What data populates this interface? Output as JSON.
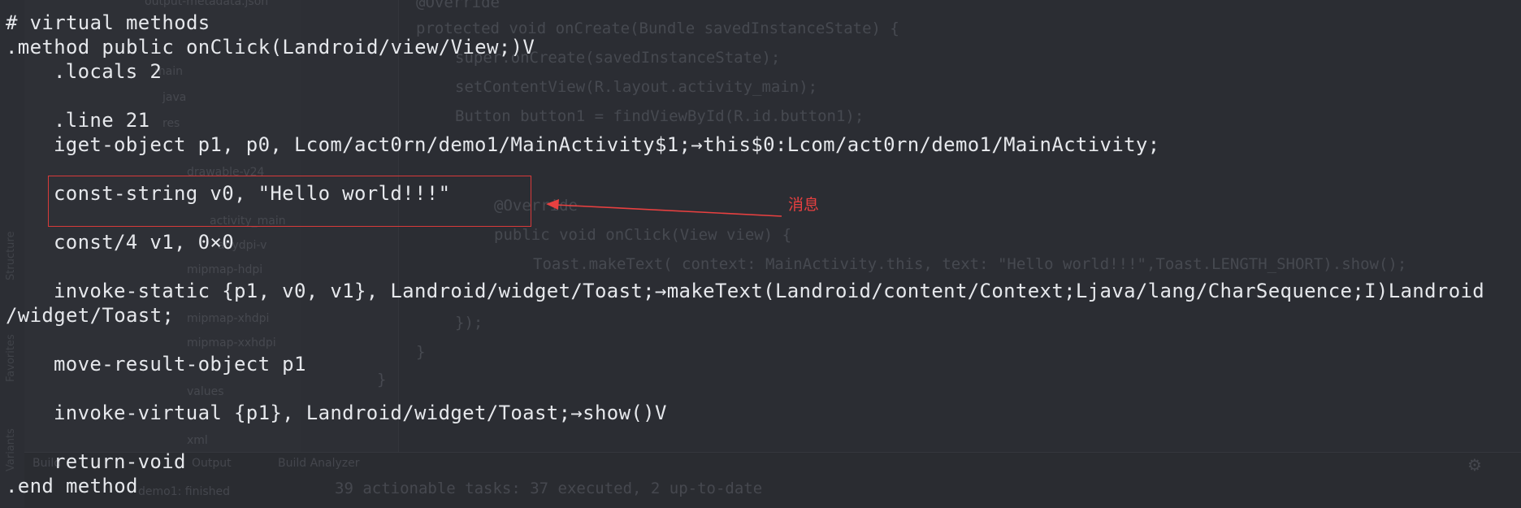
{
  "code_lines": [
    "# virtual methods",
    ".method public onClick(Landroid/view/View;)V",
    ".locals 2",
    ".line 21",
    "iget-object p1, p0, Lcom/act0rn/demo1/MainActivity$1;→this$0:Lcom/act0rn/demo1/MainActivity;",
    "const-string v0, \"Hello world!!!\"",
    "const/4 v1, 0×0",
    "invoke-static {p1, v0, v1}, Landroid/widget/Toast;→makeText(Landroid/content/Context;Ljava/lang/CharSequence;I)Landroid",
    "/widget/Toast;",
    "move-result-object p1",
    "invoke-virtual {p1}, Landroid/widget/Toast;→show()V",
    "return-void",
    ".end method"
  ],
  "annotation": {
    "label": "消息",
    "color": "#e84040"
  },
  "background_ide": {
    "java_lines": [
      "@Override",
      "protected void onCreate(Bundle savedInstanceState) {",
      "super.onCreate(savedInstanceState);",
      "setContentView(R.layout.activity_main);",
      "Button button1 = findViewById(R.id.button1);",
      "@Override",
      "public void onClick(View view) {",
      "Toast.makeText( context: MainActivity.this, text: \"Hello world!!!\",Toast.LENGTH_SHORT).show();",
      "});",
      "}",
      "}"
    ],
    "tree_items": [
      "output-metadata.json",
      "main",
      "java",
      "res",
      "drawable-v24",
      "activity_main",
      "anydpi-v",
      "mipmap-hdpi",
      "mipmap-xhdpi",
      "mipmap-xxhdpi",
      "values",
      "xml"
    ],
    "side_tabs": [
      "Structure",
      "Favorites",
      "Variants"
    ],
    "bottom_tabs": [
      "Build",
      "Output",
      "Build Analyzer"
    ],
    "build_item": "demo1: finished",
    "build_status": "39 actionable tasks: 37 executed, 2 up-to-date"
  }
}
